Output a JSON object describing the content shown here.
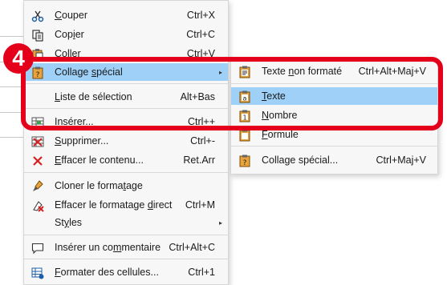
{
  "main_menu": {
    "items": [
      {
        "pre": "",
        "ul": "C",
        "post": "ouper",
        "shortcut": "Ctrl+X",
        "icon": "scissors-icon"
      },
      {
        "pre": "Cop",
        "ul": "i",
        "post": "er",
        "shortcut": "Ctrl+C",
        "icon": "copy-icon"
      },
      {
        "pre": "C",
        "ul": "o",
        "post": "ller",
        "shortcut": "Ctrl+V",
        "icon": "paste-icon"
      },
      {
        "pre": "Collage ",
        "ul": "s",
        "post": "pécial",
        "shortcut": "",
        "icon": "paste-special-icon",
        "arrow": "▸"
      },
      {
        "pre": "",
        "ul": "L",
        "post": "iste de sélection",
        "shortcut": "Alt+Bas",
        "icon": ""
      },
      {
        "pre": "",
        "ul": "I",
        "post": "nsérer...",
        "shortcut": "Ctrl++",
        "icon": "insert-cells-icon"
      },
      {
        "pre": "",
        "ul": "S",
        "post": "upprimer...",
        "shortcut": "Ctrl+-",
        "icon": "delete-cells-icon"
      },
      {
        "pre": "",
        "ul": "E",
        "post": "ffacer le contenu...",
        "shortcut": "Ret.Arr",
        "icon": "clear-icon"
      },
      {
        "pre": "Cloner le forma",
        "ul": "t",
        "post": "age",
        "shortcut": "",
        "icon": "clone-format-icon"
      },
      {
        "pre": "Effacer le formatage ",
        "ul": "d",
        "post": "irect",
        "shortcut": "Ctrl+M",
        "icon": "clear-format-icon"
      },
      {
        "pre": "St",
        "ul": "y",
        "post": "les",
        "shortcut": "",
        "icon": "",
        "arrow": "▸"
      },
      {
        "pre": "Insérer un co",
        "ul": "m",
        "post": "mentaire",
        "shortcut": "Ctrl+Alt+C",
        "icon": "comment-icon"
      },
      {
        "pre": "",
        "ul": "F",
        "post": "ormater des cellules...",
        "shortcut": "Ctrl+1",
        "icon": "format-cells-icon"
      }
    ]
  },
  "sub_menu": {
    "items": [
      {
        "pre": "Texte ",
        "ul": "n",
        "post": "on formaté",
        "shortcut": "Ctrl+Alt+Maj+V",
        "icon": "unformatted-text-icon"
      },
      {
        "pre": "",
        "ul": "T",
        "post": "exte",
        "shortcut": "",
        "icon": "text-icon"
      },
      {
        "pre": "",
        "ul": "N",
        "post": "ombre",
        "shortcut": "",
        "icon": "number-icon"
      },
      {
        "pre": "",
        "ul": "F",
        "post": "ormule",
        "shortcut": "",
        "icon": "formula-icon"
      },
      {
        "pre": "Collage spécial...",
        "ul": "",
        "post": "",
        "shortcut": "Ctrl+Maj+V",
        "icon": "paste-special-icon"
      }
    ]
  },
  "callout": {
    "step": "4",
    "color": "#e4001b"
  },
  "colors": {
    "highlight": "#9ed0f8",
    "menu_bg": "#f7f7f7"
  }
}
